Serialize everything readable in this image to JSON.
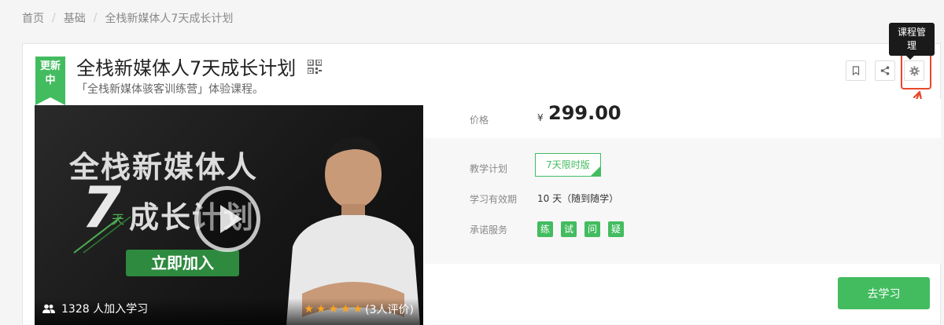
{
  "breadcrumb": {
    "items": [
      "首页",
      "基础",
      "全栈新媒体人7天成长计划"
    ],
    "separator": "/"
  },
  "course": {
    "ribbon": "更新中",
    "title": "全栈新媒体人7天成长计划",
    "subtitle": "「全栈新媒体骇客训练营」体验课程。"
  },
  "actions": {
    "bookmark_icon": "bookmark-icon",
    "share_icon": "share-icon",
    "manage_icon": "gear-icon",
    "tooltip": "课程管理"
  },
  "cover": {
    "line1": "全栈新媒体人",
    "big_number": "7",
    "tian": "天",
    "line2": "成长计划",
    "join_label": "立即加入",
    "students": "1328 人加入学习",
    "rating_stars": 5,
    "rating_text": "(3人评价)"
  },
  "price": {
    "label": "价格",
    "currency": "¥",
    "value": "299.00"
  },
  "info": {
    "plan_label": "教学计划",
    "plan_value": "7天限时版",
    "valid_label": "学习有效期",
    "valid_value": "10 天（随到随学）",
    "service_label": "承诺服务",
    "services": [
      "练",
      "试",
      "问",
      "疑"
    ]
  },
  "study_button": "去学习",
  "colors": {
    "accent": "#43bc60",
    "annotation": "#e8472a",
    "star": "#f7a623"
  }
}
